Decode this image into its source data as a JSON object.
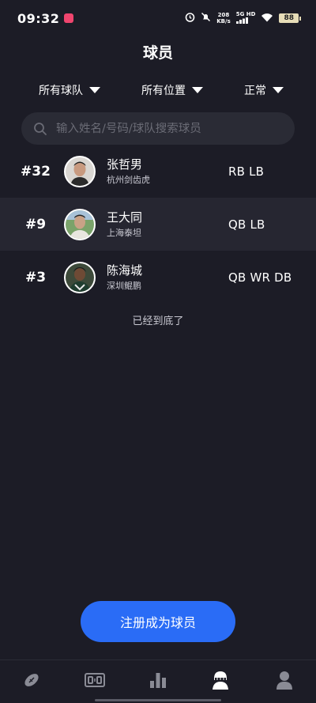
{
  "status_bar": {
    "time": "09:32",
    "speed_value": "208",
    "speed_unit": "KB/s",
    "network": "5G HD",
    "battery": "88"
  },
  "header": {
    "title": "球员"
  },
  "filters": {
    "team": "所有球队",
    "position": "所有位置",
    "status": "正常"
  },
  "search": {
    "placeholder": "输入姓名/号码/球队搜索球员"
  },
  "players": [
    {
      "number": "#32",
      "name": "张哲男",
      "team": "杭州剑齿虎",
      "positions": "RB  LB"
    },
    {
      "number": "#9",
      "name": "王大同",
      "team": "上海泰坦",
      "positions": "QB  LB"
    },
    {
      "number": "#3",
      "name": "陈海城",
      "team": "深圳鲲鹏",
      "positions": "QB  WR DB"
    }
  ],
  "list_end_text": "已经到底了",
  "register_button": "注册成为球员",
  "tab_bar": {
    "icons": [
      "football-icon",
      "scoreboard-icon",
      "stats-icon",
      "player-helmet-icon",
      "profile-icon"
    ],
    "active_tab": "player-helmet-icon",
    "active_color": "#ffffff",
    "inactive_color": "#8a8b95"
  },
  "colors": {
    "background": "#1c1c26",
    "accent": "#2a6cf6",
    "search_bg": "#2a2b35"
  }
}
